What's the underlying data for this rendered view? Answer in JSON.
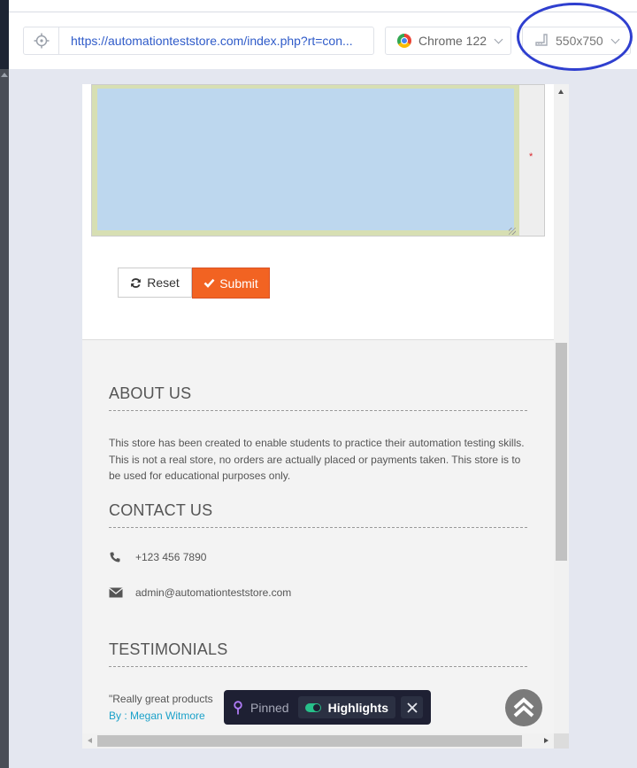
{
  "toolbar": {
    "url": "https://automationteststore.com/index.php?rt=con...",
    "browser": "Chrome 122",
    "viewport_size": "550x750"
  },
  "form": {
    "required_mark": "*",
    "reset_label": "Reset",
    "submit_label": "Submit"
  },
  "footer": {
    "about_title": "ABOUT US",
    "about_text": "This store has been created to enable students to practice their automation testing skills. This is not a real store, no orders are actually placed or payments taken. This store is to be used for educational purposes only.",
    "contact_title": "CONTACT US",
    "phone": "+123 456 7890",
    "email": "admin@automationteststore.com",
    "testimonials_title": "TESTIMONIALS",
    "quote": "\"Really great products",
    "quote_by": "By : Megan Witmore"
  },
  "pinned_bar": {
    "pinned_label": "Pinned",
    "highlights_label": "Highlights",
    "highlights_on": true
  },
  "colors": {
    "accent_submit": "#f26322",
    "link_blue": "#2f5bc9",
    "testimonial_author": "#1ba1c9",
    "annotation_circle": "#2f3fcf",
    "textarea_fill": "#bdd7ee",
    "toggle_on": "#27c08a"
  }
}
